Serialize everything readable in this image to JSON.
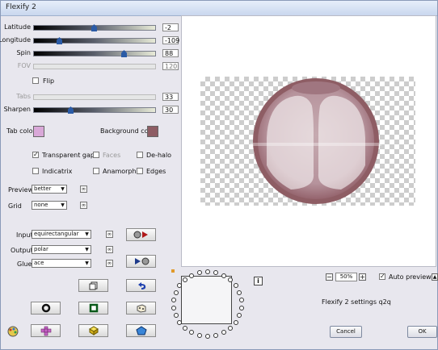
{
  "window": {
    "title": "Flexify 2"
  },
  "sliders": [
    {
      "label": "Latitude",
      "value": "-2",
      "level": 0.49,
      "enabled": true
    },
    {
      "label": "Longitude",
      "value": "-109",
      "level": 0.2,
      "enabled": true
    },
    {
      "label": "Spin",
      "value": "88",
      "level": 0.74,
      "enabled": true
    },
    {
      "label": "FOV",
      "value": "120",
      "level": null,
      "enabled": false
    }
  ],
  "flip": {
    "label": "Flip",
    "checked": false
  },
  "sliders2": [
    {
      "label": "Tabs",
      "value": "33",
      "level": null,
      "enabled": false
    },
    {
      "label": "Sharpen",
      "value": "30",
      "level": 0.3,
      "enabled": true
    }
  ],
  "colors": {
    "tab_label": "Tab color",
    "tab_color": "#d9a8d8",
    "bg_label": "Background color",
    "bg_color": "#8e5d64"
  },
  "checks": {
    "transparent_gaps": "Transparent gaps",
    "faces": "Faces",
    "de_halo": "De-halo",
    "indicatrix": "Indicatrix",
    "anamorph": "Anamorph",
    "edges": "Edges"
  },
  "preview_sel": {
    "label": "Preview",
    "value": "better"
  },
  "grid_sel": {
    "label": "Grid",
    "value": "none"
  },
  "input_sel": {
    "label": "Input",
    "value": "equirectangular"
  },
  "output_sel": {
    "label": "Output",
    "value": "polar"
  },
  "glue_sel": {
    "label": "Glue",
    "value": "ace"
  },
  "zoom": {
    "value": "50%"
  },
  "auto_preview": {
    "label": "Auto preview",
    "checked": true
  },
  "settings_name": "Flexify 2 settings q2q",
  "buttons": {
    "cancel": "Cancel",
    "ok": "OK"
  },
  "accent": {
    "ring": "#8e5d64",
    "ring_light": "#e8d8df"
  }
}
